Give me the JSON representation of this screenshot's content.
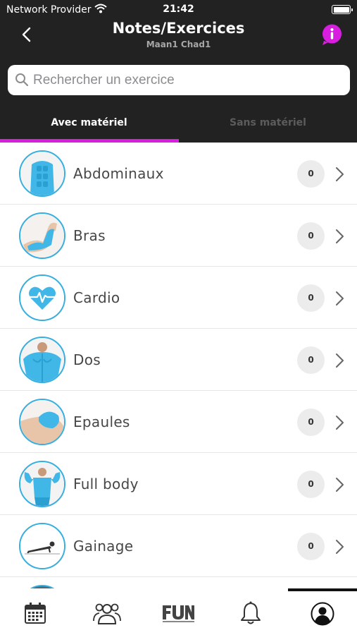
{
  "status_bar": {
    "carrier": "Network Provider",
    "time": "21:42"
  },
  "nav": {
    "title": "Notes/Exercices",
    "subtitle": "Maan1 Chad1",
    "info_badge": "i"
  },
  "search": {
    "placeholder": "Rechercher un exercice",
    "value": ""
  },
  "tabs": [
    {
      "label": "Avec matériel",
      "active": true
    },
    {
      "label": "Sans matériel",
      "active": false
    }
  ],
  "exercises": [
    {
      "label": "Abdominaux",
      "count": "0",
      "icon": "abs-icon"
    },
    {
      "label": "Bras",
      "count": "0",
      "icon": "arm-icon"
    },
    {
      "label": "Cardio",
      "count": "0",
      "icon": "heart-pulse-icon"
    },
    {
      "label": "Dos",
      "count": "0",
      "icon": "back-icon"
    },
    {
      "label": "Epaules",
      "count": "0",
      "icon": "shoulder-icon"
    },
    {
      "label": "Full body",
      "count": "0",
      "icon": "full-body-icon"
    },
    {
      "label": "Gainage",
      "count": "0",
      "icon": "plank-icon"
    }
  ],
  "tab_bar": [
    {
      "name": "calendar-icon"
    },
    {
      "name": "group-icon"
    },
    {
      "name": "fun-logo-icon"
    },
    {
      "name": "bell-icon"
    },
    {
      "name": "profile-icon"
    }
  ],
  "colors": {
    "header_bg": "#222223",
    "accent": "#d81fe0",
    "thumb_border": "#35aee0",
    "muscle": "#41b7e8"
  }
}
